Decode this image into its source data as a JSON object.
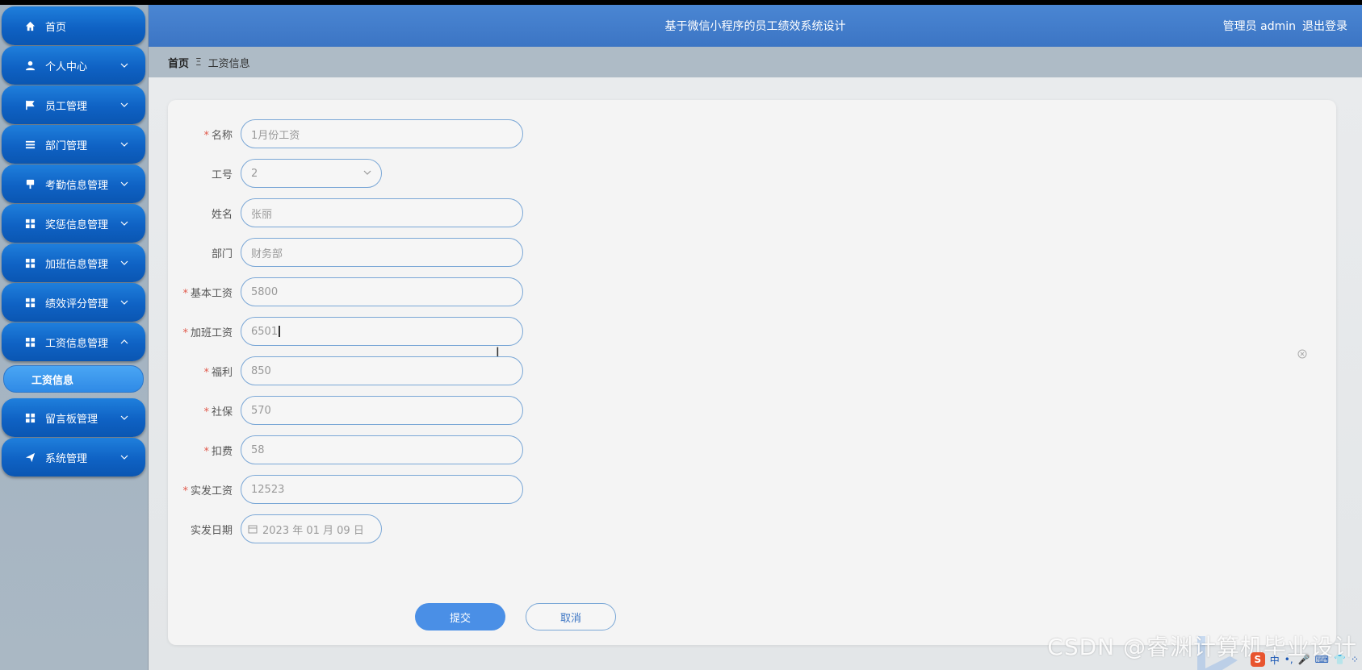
{
  "header": {
    "title": "基于微信小程序的员工绩效系统设计",
    "user": "管理员 admin",
    "logout": "退出登录"
  },
  "sidebar": {
    "items": [
      {
        "label": "首页",
        "icon": "home-icon",
        "expandable": false
      },
      {
        "label": "个人中心",
        "icon": "user-icon",
        "expandable": true
      },
      {
        "label": "员工管理",
        "icon": "flag-icon",
        "expandable": true
      },
      {
        "label": "部门管理",
        "icon": "list-icon",
        "expandable": true
      },
      {
        "label": "考勤信息管理",
        "icon": "pin-icon",
        "expandable": true
      },
      {
        "label": "奖惩信息管理",
        "icon": "grid-icon",
        "expandable": true
      },
      {
        "label": "加班信息管理",
        "icon": "grid-icon",
        "expandable": true
      },
      {
        "label": "绩效评分管理",
        "icon": "grid-icon",
        "expandable": true
      },
      {
        "label": "工资信息管理",
        "icon": "grid-icon",
        "expandable": true,
        "expanded": true
      },
      {
        "label": "留言板管理",
        "icon": "grid-icon",
        "expandable": true
      },
      {
        "label": "系统管理",
        "icon": "send-icon",
        "expandable": true
      }
    ],
    "subitem": "工资信息"
  },
  "breadcrumb": {
    "home": "首页",
    "separator": "Ξ",
    "current": "工资信息"
  },
  "form": {
    "fields": [
      {
        "label": "名称",
        "required": true,
        "value": "1月份工资",
        "type": "text"
      },
      {
        "label": "工号",
        "required": false,
        "value": "2",
        "type": "select"
      },
      {
        "label": "姓名",
        "required": false,
        "value": "张丽",
        "type": "text"
      },
      {
        "label": "部门",
        "required": false,
        "value": "财务部",
        "type": "text"
      },
      {
        "label": "基本工资",
        "required": true,
        "value": "5800",
        "type": "text"
      },
      {
        "label": "加班工资",
        "required": true,
        "value": "6501",
        "type": "text",
        "focused": true
      },
      {
        "label": "福利",
        "required": true,
        "value": "850",
        "type": "text"
      },
      {
        "label": "社保",
        "required": true,
        "value": "570",
        "type": "text"
      },
      {
        "label": "扣费",
        "required": true,
        "value": "58",
        "type": "text"
      },
      {
        "label": "实发工资",
        "required": true,
        "value": "12523",
        "type": "text"
      },
      {
        "label": "实发日期",
        "required": false,
        "value": "2023 年 01 月 09 日",
        "type": "date"
      }
    ],
    "submit": "提交",
    "cancel": "取消"
  },
  "watermark": "CSDN @睿渊计算机毕业设计",
  "ime": {
    "mode": "中"
  },
  "colors": {
    "primary": "#3c75c4",
    "sidebar_item": "#0f62c4",
    "required": "#e0584a"
  }
}
